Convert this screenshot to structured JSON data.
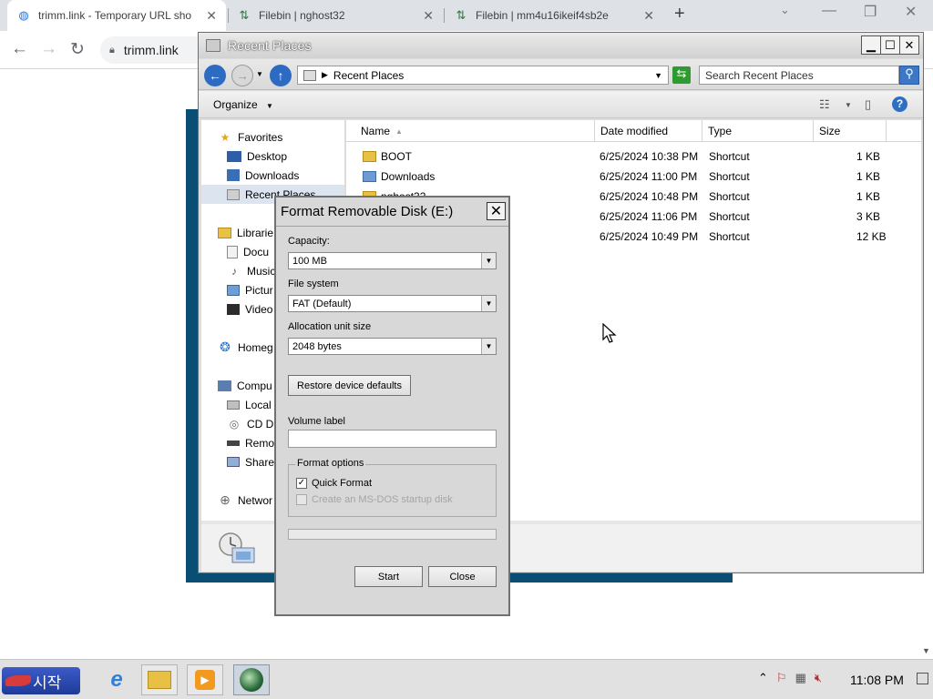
{
  "browser": {
    "tabs": [
      {
        "title": "trimm.link - Temporary URL sho",
        "icon": "globe-icon",
        "active": true
      },
      {
        "title": "Filebin | nghost32",
        "icon": "filebin-icon",
        "active": false
      },
      {
        "title": "Filebin | mm4u16ikeif4sb2e",
        "icon": "filebin-icon",
        "active": false
      }
    ],
    "new_tab": "+",
    "url": "trimm.link"
  },
  "explorer": {
    "title": "Recent Places",
    "breadcrumb": "Recent Places",
    "search_placeholder": "Search Recent Places",
    "organize_label": "Organize",
    "nav": [
      {
        "label": "Favorites",
        "icon": "star-icon"
      },
      {
        "label": "Desktop",
        "icon": "desktop-icon"
      },
      {
        "label": "Downloads",
        "icon": "downloads-icon"
      },
      {
        "label": "Recent Places",
        "icon": "recent-places-icon",
        "selected": true
      },
      {
        "label": "Librarie",
        "icon": "libraries-icon"
      },
      {
        "label": "Docu",
        "icon": "documents-icon"
      },
      {
        "label": "Music",
        "icon": "music-icon"
      },
      {
        "label": "Pictur",
        "icon": "pictures-icon"
      },
      {
        "label": "Video",
        "icon": "videos-icon"
      },
      {
        "label": "Homeg",
        "icon": "homegroup-icon"
      },
      {
        "label": "Compu",
        "icon": "computer-icon"
      },
      {
        "label": "Local",
        "icon": "local-disk-icon"
      },
      {
        "label": "CD Dr",
        "icon": "cd-drive-icon"
      },
      {
        "label": "Remo",
        "icon": "removable-disk-icon"
      },
      {
        "label": "Share",
        "icon": "network-share-icon"
      },
      {
        "label": "Networ",
        "icon": "network-icon"
      }
    ],
    "columns": [
      "Name",
      "Date modified",
      "Type",
      "Size"
    ],
    "rows": [
      {
        "name": "BOOT",
        "date": "6/25/2024 10:38 PM",
        "type": "Shortcut",
        "size": "1 KB"
      },
      {
        "name": "Downloads",
        "date": "6/25/2024 11:00 PM",
        "type": "Shortcut",
        "size": "1 KB"
      },
      {
        "name": "nghost32",
        "date": "6/25/2024 10:48 PM",
        "type": "Shortcut",
        "size": "1 KB"
      },
      {
        "name": "",
        "date": "6/25/2024 11:06 PM",
        "type": "Shortcut",
        "size": "3 KB"
      },
      {
        "name": "",
        "date": "6/25/2024 10:49 PM",
        "type": "Shortcut",
        "size": "12 KB"
      }
    ]
  },
  "format_dialog": {
    "title": "Format Removable Disk (E:)",
    "capacity_label": "Capacity:",
    "capacity_value": "100 MB",
    "fs_label": "File system",
    "fs_value": "FAT (Default)",
    "alloc_label": "Allocation unit size",
    "alloc_value": "2048 bytes",
    "restore_label": "Restore device defaults",
    "volume_label": "Volume label",
    "volume_value": "",
    "options_label": "Format options",
    "quick_format_label": "Quick Format",
    "quick_format_checked": true,
    "msdos_label": "Create an MS-DOS startup disk",
    "start_label": "Start",
    "close_label": "Close"
  },
  "taskbar": {
    "start_label": "시작",
    "clock": "11:08 PM",
    "start_color": "#2a49b3"
  }
}
